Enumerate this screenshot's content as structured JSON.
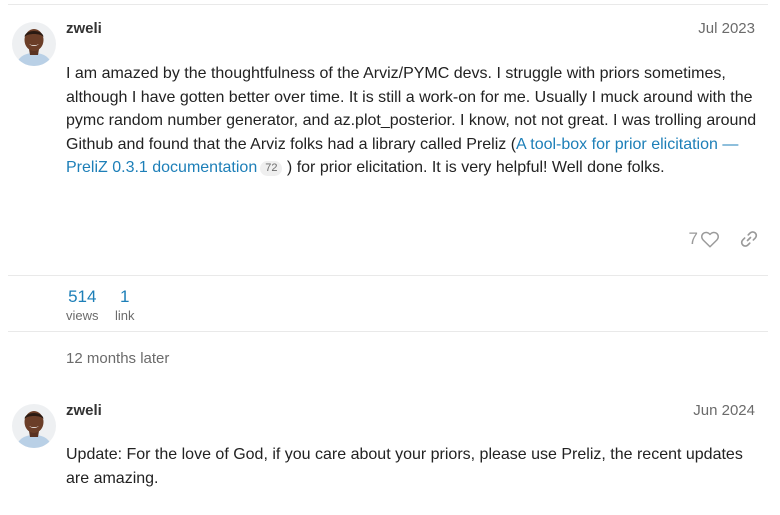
{
  "posts": [
    {
      "username": "zweli",
      "date": "Jul 2023",
      "body_before": "I am amazed by the thoughtfulness of the Arviz/PYMC devs. I struggle with priors sometimes, although I have gotten better over time. It is still a work-on for me. Usually I muck around with the pymc random number generator, and az.plot_posterior. I know, not not great. I was trolling around Github and found that the Arviz folks had a library called Preliz (",
      "link_text": "A tool-box for prior elicitation — PreliZ 0.3.1 documentation",
      "link_clicks": "72",
      "body_after": ") for prior elicitation. It is very helpful! Well done folks.",
      "likes": "7"
    },
    {
      "username": "zweli",
      "date": "Jun 2024",
      "body": "Update: For the love of God, if you care about your priors, please use Preliz, the recent updates are amazing."
    }
  ],
  "topic_stats": {
    "views_count": "514",
    "views_label": "views",
    "links_count": "1",
    "links_label": "link"
  },
  "time_gap": "12 months later",
  "icons": {
    "like": "heart-icon",
    "share": "link-icon"
  },
  "colors": {
    "link": "#1d7fb8",
    "muted": "#6b6b6b",
    "divider": "#e9e9e9"
  }
}
